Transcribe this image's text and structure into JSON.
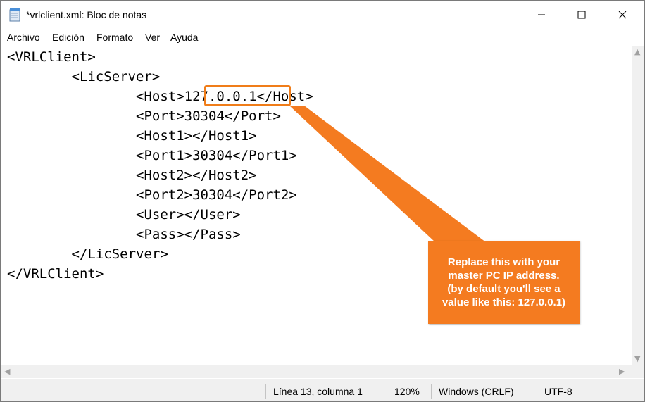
{
  "window": {
    "title": "*vrlclient.xml: Bloc de notas",
    "buttons": [
      "minimize",
      "maximize",
      "close"
    ]
  },
  "menu": [
    "Archivo",
    "Edición",
    "Formato",
    "Ver",
    "Ayuda"
  ],
  "editor": {
    "lines": [
      "<VRLClient>",
      "        <LicServer>",
      "                <Host>127.0.0.1</Host>",
      "                <Port>30304</Port>",
      "                <Host1></Host1>",
      "                <Port1>30304</Port1>",
      "                <Host2></Host2>",
      "                <Port2>30304</Port2>",
      "                <User></User>",
      "                <Pass></Pass>",
      "        </LicServer>",
      "</VRLClient>"
    ]
  },
  "status": {
    "position": "Línea 13, columna 1",
    "zoom": "120%",
    "line_endings": "Windows (CRLF)",
    "encoding": "UTF-8"
  },
  "annotation": {
    "highlighted_text": "127.0.0.1",
    "callout_lines": [
      "Replace this with your",
      "master PC IP address.",
      "(by default you'll see a",
      "value like this: 127.0.0.1)"
    ],
    "color": "#f47b20"
  }
}
